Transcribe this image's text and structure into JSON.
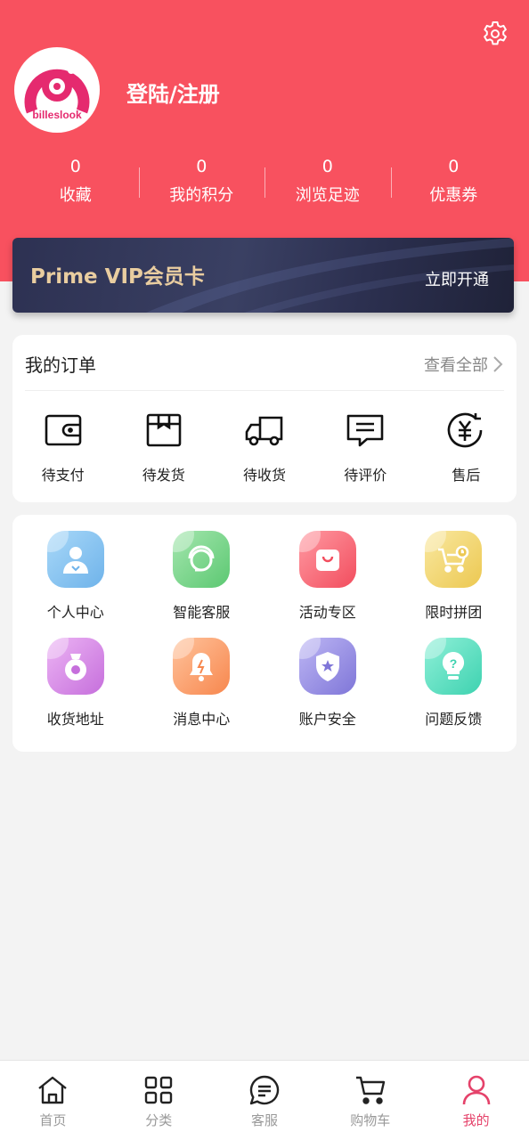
{
  "header": {
    "login_label": "登陆/注册",
    "avatar_brand": "billeslook",
    "settings_icon": "gear-icon",
    "bg_color": "#f8515f"
  },
  "stats": [
    {
      "value": "0",
      "label": "收藏"
    },
    {
      "value": "0",
      "label": "我的积分"
    },
    {
      "value": "0",
      "label": "浏览足迹"
    },
    {
      "value": "0",
      "label": "优惠券"
    }
  ],
  "vip": {
    "title": "Prime VIP会员卡",
    "action": "立即开通"
  },
  "orders": {
    "title": "我的订单",
    "view_all": "查看全部",
    "items": [
      {
        "label": "待支付",
        "icon": "wallet-icon"
      },
      {
        "label": "待发货",
        "icon": "package-icon"
      },
      {
        "label": "待收货",
        "icon": "truck-icon"
      },
      {
        "label": "待评价",
        "icon": "comment-icon"
      },
      {
        "label": "售后",
        "icon": "yuan-refund-icon"
      }
    ]
  },
  "services": [
    {
      "label": "个人中心",
      "icon": "user-icon",
      "color": "#8cc8f2"
    },
    {
      "label": "智能客服",
      "icon": "headset-icon",
      "color": "#7fd88e"
    },
    {
      "label": "活动专区",
      "icon": "shopping-bag-icon",
      "color": "#f86a78"
    },
    {
      "label": "限时拼团",
      "icon": "cart-clock-icon",
      "color": "#f2d66a"
    },
    {
      "label": "收货地址",
      "icon": "location-icon",
      "color": "#d98be8"
    },
    {
      "label": "消息中心",
      "icon": "bell-icon",
      "color": "#fba06e"
    },
    {
      "label": "账户安全",
      "icon": "shield-icon",
      "color": "#9b94e6"
    },
    {
      "label": "问题反馈",
      "icon": "lightbulb-question-icon",
      "color": "#5fe0c6"
    }
  ],
  "tabbar": {
    "active_color": "#e5426a",
    "items": [
      {
        "label": "首页",
        "icon": "home-icon"
      },
      {
        "label": "分类",
        "icon": "grid-icon"
      },
      {
        "label": "客服",
        "icon": "chat-icon"
      },
      {
        "label": "购物车",
        "icon": "cart-icon"
      },
      {
        "label": "我的",
        "icon": "profile-icon"
      }
    ]
  }
}
